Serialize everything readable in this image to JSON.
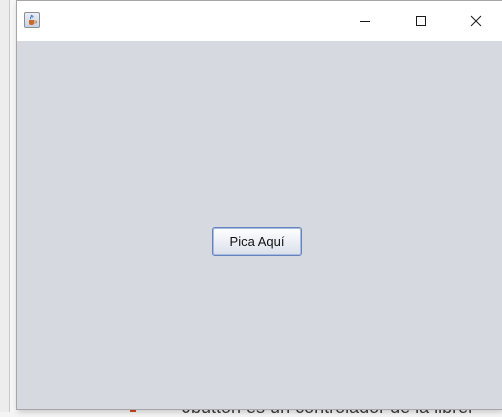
{
  "window": {
    "title": "",
    "icon": "java-cup-icon",
    "controls": {
      "minimize_icon": "minimize-icon",
      "maximize_icon": "maximize-icon",
      "close_icon": "close-icon"
    },
    "background_color": "#d6d9e0"
  },
  "main": {
    "button_label": "Pica Aquí"
  },
  "background_document": {
    "partial_text": "Jbutton es un controlador de la librer"
  }
}
